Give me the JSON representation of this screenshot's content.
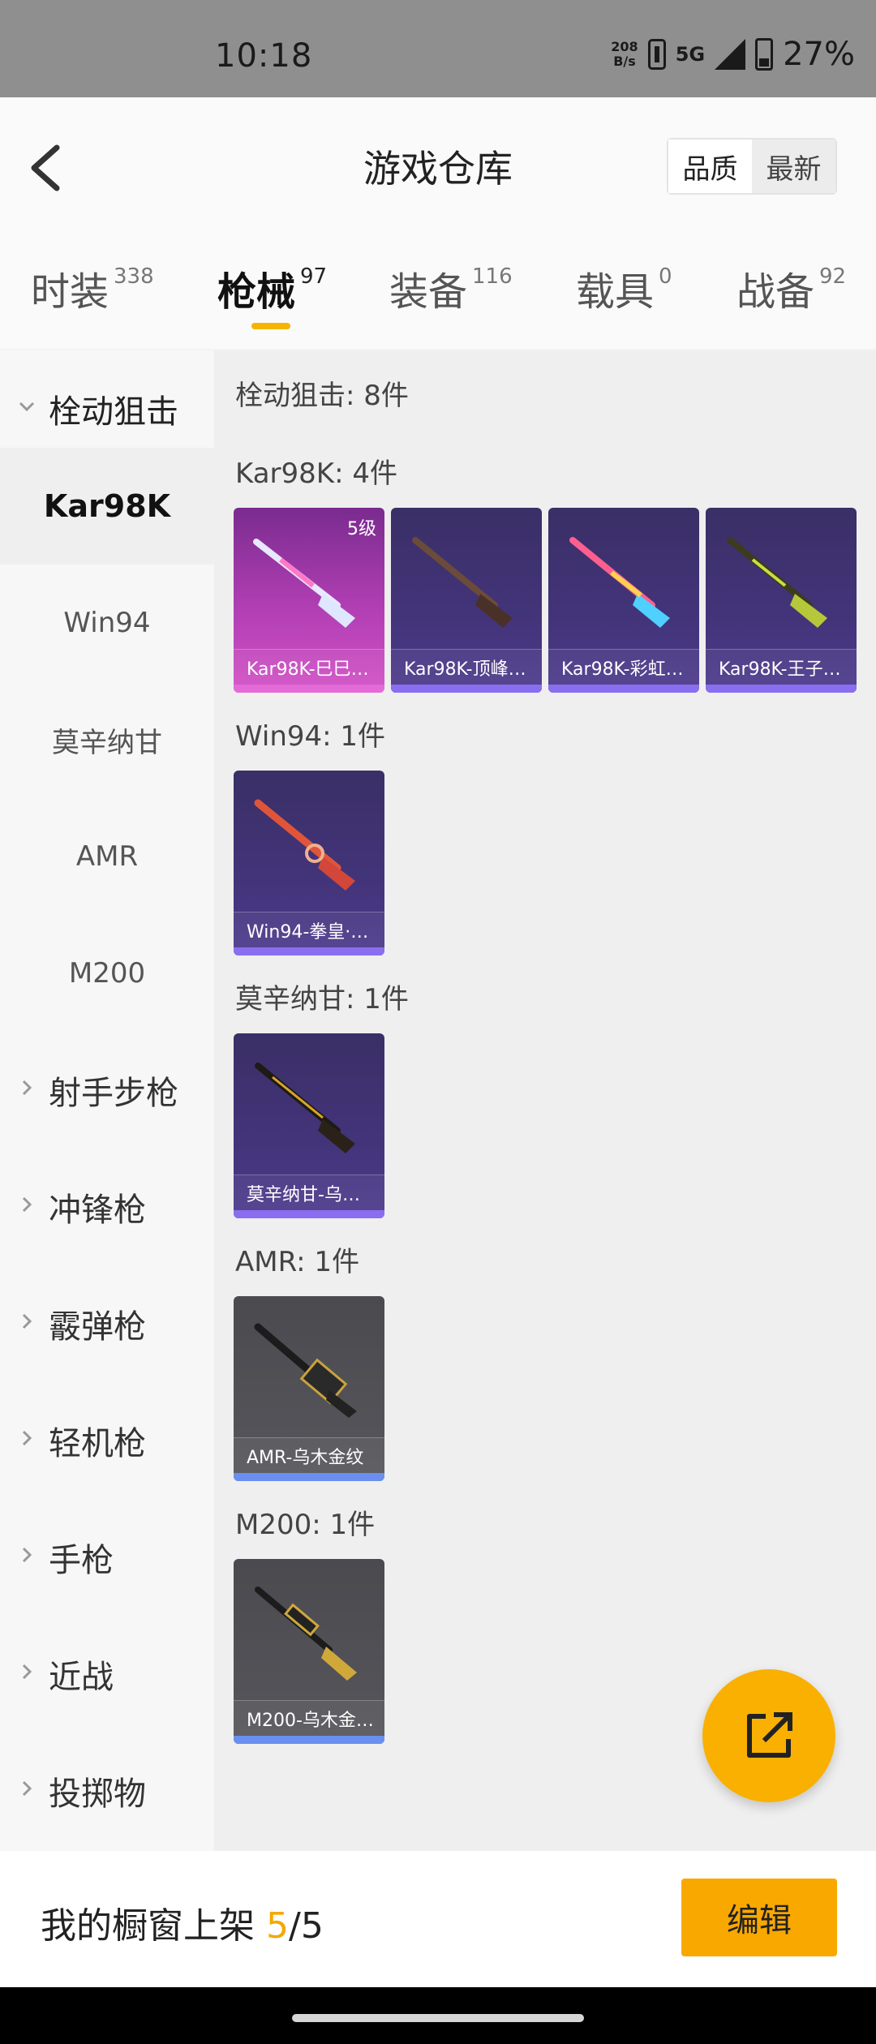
{
  "status_bar": {
    "time": "10:18",
    "net_speed_value": "208",
    "net_speed_unit": "B/s",
    "network": "5G",
    "battery": "27%"
  },
  "header": {
    "title": "游戏仓库",
    "sort_quality": "品质",
    "sort_newest": "最新"
  },
  "tabs": [
    {
      "label": "时装",
      "count": "338"
    },
    {
      "label": "枪械",
      "count": "97"
    },
    {
      "label": "装备",
      "count": "116"
    },
    {
      "label": "载具",
      "count": "0"
    },
    {
      "label": "战备",
      "count": "92"
    }
  ],
  "sidebar": {
    "group": "栓动狙击",
    "subitems": [
      "Kar98K",
      "Win94",
      "莫辛纳甘",
      "AMR",
      "M200"
    ],
    "categories": [
      "射手步枪",
      "冲锋枪",
      "霰弹枪",
      "轻机枪",
      "手枪",
      "近战",
      "投掷物"
    ]
  },
  "content": {
    "summary": "栓动狙击: 8件",
    "sections": [
      {
        "header": "Kar98K: 4件",
        "items": [
          {
            "name": "Kar98K-巳巳…",
            "level": "5级"
          },
          {
            "name": "Kar98K-顶峰…"
          },
          {
            "name": "Kar98K-彩虹…"
          },
          {
            "name": "Kar98K-王子…"
          }
        ]
      },
      {
        "header": "Win94: 1件",
        "items": [
          {
            "name": "Win94-拳皇·…"
          }
        ]
      },
      {
        "header": "莫辛纳甘: 1件",
        "items": [
          {
            "name": "莫辛纳甘-乌…"
          }
        ]
      },
      {
        "header": "AMR: 1件",
        "items": [
          {
            "name": "AMR-乌木金纹"
          }
        ]
      },
      {
        "header": "M200: 1件",
        "items": [
          {
            "name": "M200-乌木金…"
          }
        ]
      }
    ]
  },
  "bottom": {
    "label": "我的橱窗上架",
    "current": "5",
    "total": "/5",
    "edit": "编辑"
  },
  "colors": {
    "accent": "#f9b000",
    "purple_card": "#43347a",
    "pink_card": "#b23fb4",
    "gray_card": "#56565c"
  },
  "icons": {
    "back": "chevron-left-icon",
    "fab": "share-external-icon",
    "expand": "chevron-down-icon",
    "collapsed": "chevron-right-icon"
  }
}
